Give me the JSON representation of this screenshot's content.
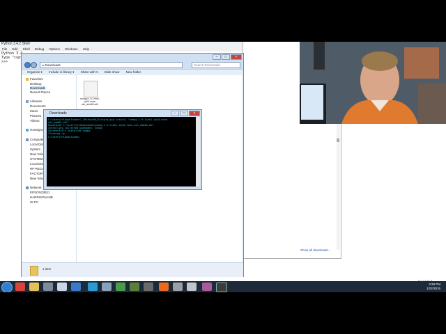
{
  "python_shell": {
    "title": "Python 3.4.2 Shell",
    "menu": [
      "File",
      "Edit",
      "Shell",
      "Debug",
      "Options",
      "Windows",
      "Help"
    ],
    "lines": [
      "Python 3.4",
      "Type \"copyr",
      ">>>"
    ],
    "status": "Ln: 3 Col: 4"
  },
  "explorer": {
    "path": "Downloads",
    "search_placeholder": "Search Downloads",
    "toolbar": [
      "Organize ▾",
      "Include in library ▾",
      "Share with ▾",
      "Slide show",
      "New folder"
    ],
    "nav": {
      "favorites_header": "Favorites",
      "favorites": [
        "Desktop",
        "Downloads",
        "Recent Places"
      ],
      "libraries_header": "Libraries",
      "libraries": [
        "Documents",
        "Music",
        "Pictures",
        "Videos"
      ],
      "homegroup": "Homegroup",
      "computer_header": "Computer",
      "computer": [
        "Local Disk",
        "System",
        "New Volume",
        "SYSTEM",
        "Local Disk",
        "HP-RECOVERY",
        "FACTORY",
        "New Volume"
      ],
      "network_header": "Network",
      "network": [
        "EPSON23B11",
        "HARRISON-INB",
        "HI-PC"
      ]
    },
    "file_label": "numpy-1.9.1+mkl-cp34-none-win_amd64.whl",
    "item_count": "1 item"
  },
  "downloads_panel": {
    "show_all": "Show all downloads..."
  },
  "cmd": {
    "title": "Downloads",
    "lines": [
      "C:\\Users\\H\\Downloads>C:/Python34/Scripts/pip install \"numpy-1.9.1+mkl-cp34-none-",
      "win_amd64.whl\"",
      "Unpacking c:\\users\\h\\downloads\\numpy-1.9.1+mkl-cp34-none-win_amd64.whl",
      "Installing collected packages: numpy",
      "Successfully installed numpy",
      "Cleaning up...",
      "",
      "C:\\Users\\H\\Downloads>"
    ]
  },
  "taskbar": {
    "time": "3:28 PM",
    "date": "1/22/2015"
  },
  "colors": {
    "taskbar": "#1d2a3a",
    "cmd_text": "#29c4d8",
    "window_frame": "#cfe0f2"
  }
}
